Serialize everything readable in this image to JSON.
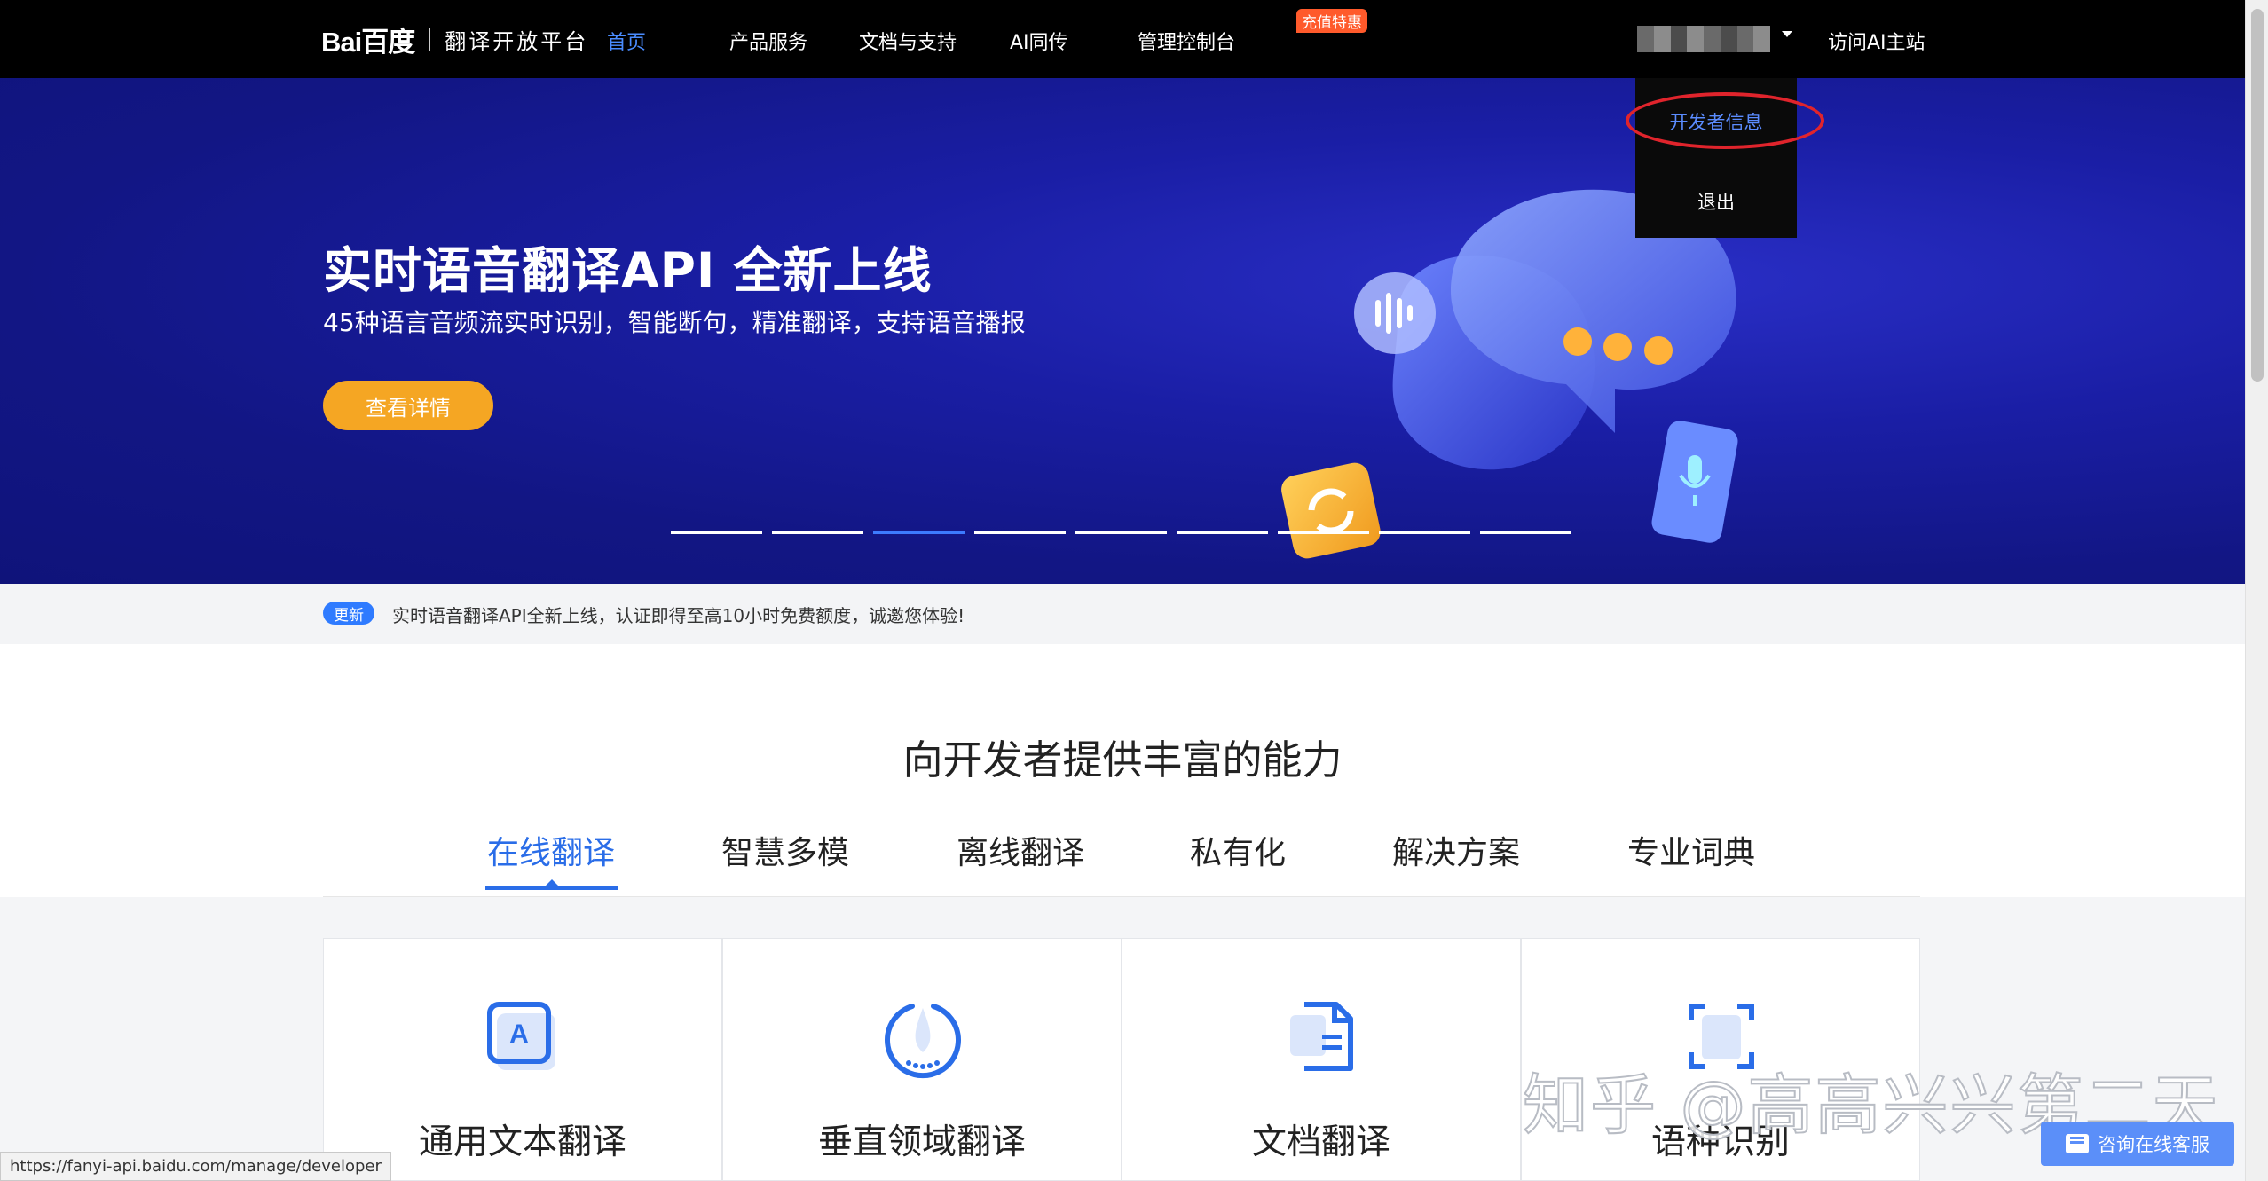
{
  "brand": {
    "logo_text": "Bai百度",
    "platform": "翻译开放平台"
  },
  "nav": {
    "items": [
      "首页",
      "产品服务",
      "文档与支持",
      "AI同传",
      "管理控制台"
    ],
    "promo_badge": "充值特惠",
    "visit_ai": "访问AI主站"
  },
  "user_menu": {
    "items": [
      "开发者信息",
      "退出"
    ]
  },
  "hero": {
    "title": "实时语音翻译API 全新上线",
    "subtitle": "45种语言音频流实时识别，智能断句，精准翻译，支持语音播报",
    "button": "查看详情",
    "carousel_count": 9,
    "carousel_active": 3
  },
  "notice": {
    "tag": "更新",
    "text": "实时语音翻译API全新上线，认证即得至高10小时免费额度，诚邀您体验!"
  },
  "section": {
    "title": "向开发者提供丰富的能力",
    "tabs": [
      "在线翻译",
      "智慧多模",
      "离线翻译",
      "私有化",
      "解决方案",
      "专业词典"
    ],
    "active_tab": 0
  },
  "cards": [
    {
      "label": "通用文本翻译",
      "icon": "text-translate-icon"
    },
    {
      "label": "垂直领域翻译",
      "icon": "domain-translate-icon"
    },
    {
      "label": "文档翻译",
      "icon": "document-translate-icon"
    },
    {
      "label": "语种识别",
      "icon": "language-detect-icon"
    }
  ],
  "watermark": "知乎 @高高兴兴第二天",
  "chat_button": "咨询在线客服",
  "status_url": "https://fanyi-api.baidu.com/manage/developer",
  "colors": {
    "accent": "#2a6de8",
    "button_orange": "#f5a623",
    "hero_blue": "#1a1ea5",
    "highlight_red": "#e0242c"
  }
}
